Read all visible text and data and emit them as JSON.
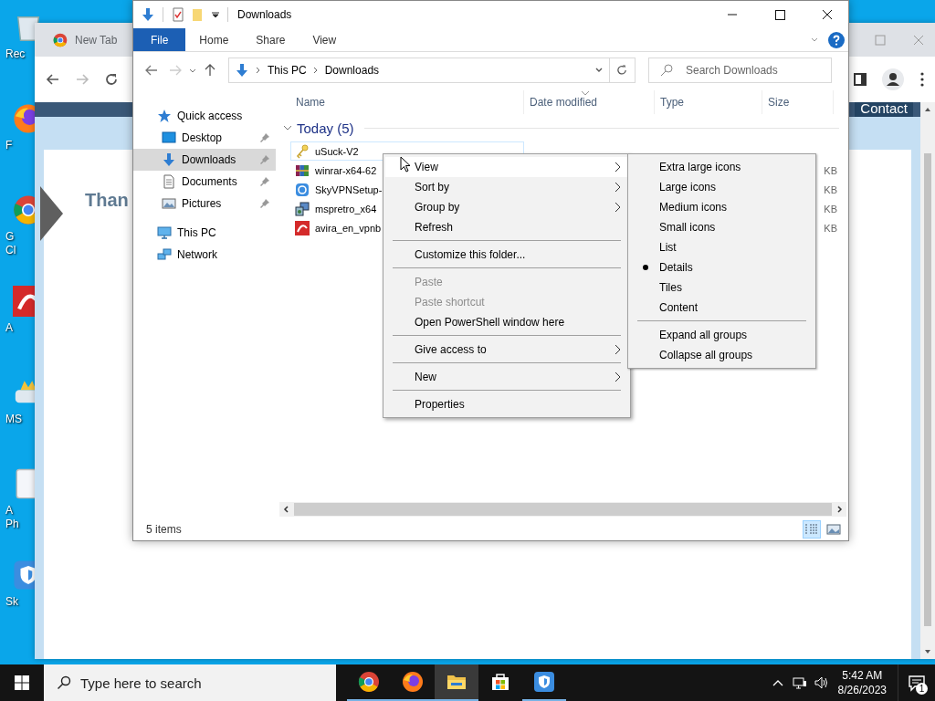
{
  "desktop": {
    "icons": [
      {
        "kind": "bin",
        "label": [
          "Rec"
        ]
      },
      {
        "kind": "firefox",
        "label": [
          "F"
        ]
      },
      {
        "kind": "chrome",
        "label": [
          "G",
          "Cl"
        ]
      },
      {
        "kind": "avira",
        "label": [
          "A"
        ]
      },
      {
        "kind": "game",
        "label": [
          "MS"
        ]
      },
      {
        "kind": "doc",
        "label": [
          "A",
          "Ph"
        ]
      },
      {
        "kind": "vpn",
        "label": [
          "Sk"
        ]
      }
    ]
  },
  "browser": {
    "tab": "New Tab",
    "banner_button": "Contact",
    "heading": "Than"
  },
  "explorer": {
    "title": "Downloads",
    "ribbon_tabs": [
      {
        "label": "File",
        "selected": true
      },
      {
        "label": "Home",
        "selected": false
      },
      {
        "label": "Share",
        "selected": false
      },
      {
        "label": "View",
        "selected": false
      }
    ],
    "breadcrumb": [
      "This PC",
      "Downloads"
    ],
    "search": {
      "placeholder": "Search Downloads"
    },
    "nav": [
      {
        "label": "Quick access",
        "kind": "star",
        "selected": false,
        "children": [
          {
            "label": "Desktop",
            "kind": "desktop",
            "pinned": true,
            "selected": false
          },
          {
            "label": "Downloads",
            "kind": "download",
            "pinned": true,
            "selected": true
          },
          {
            "label": "Documents",
            "kind": "document",
            "pinned": true,
            "selected": false
          },
          {
            "label": "Pictures",
            "kind": "pictures",
            "pinned": true,
            "selected": false
          }
        ]
      },
      {
        "label": "This PC",
        "kind": "pc",
        "selected": false
      },
      {
        "label": "Network",
        "kind": "network",
        "selected": false
      }
    ],
    "columns": [
      "Name",
      "Date modified",
      "Type",
      "Size"
    ],
    "group": {
      "label": "Today (5)",
      "expanded": true
    },
    "files": [
      {
        "name": "uSuck-V2",
        "kind": "key",
        "focused": true
      },
      {
        "name": "winrar-x64-62",
        "kind": "archive",
        "size": "KB",
        "focused": false
      },
      {
        "name": "SkyVPNSetup-",
        "kind": "vpn",
        "size": "KB",
        "focused": false
      },
      {
        "name": "mspretro_x64",
        "kind": "setup",
        "size": "KB",
        "focused": false
      },
      {
        "name": "avira_en_vpnb",
        "kind": "avira",
        "size": "KB",
        "focused": false
      }
    ],
    "status": "5 items",
    "view_buttons": [
      {
        "kind": "details",
        "selected": true
      },
      {
        "kind": "thumbnails",
        "selected": false
      }
    ]
  },
  "context_menu": [
    {
      "kind": "item",
      "label": "View",
      "submenu": true,
      "highlighted": true,
      "disabled": false
    },
    {
      "kind": "item",
      "label": "Sort by",
      "submenu": true,
      "highlighted": false,
      "disabled": false
    },
    {
      "kind": "item",
      "label": "Group by",
      "submenu": true,
      "highlighted": false,
      "disabled": false
    },
    {
      "kind": "item",
      "label": "Refresh",
      "submenu": false,
      "highlighted": false,
      "disabled": false
    },
    {
      "kind": "separator"
    },
    {
      "kind": "item",
      "label": "Customize this folder...",
      "submenu": false,
      "highlighted": false,
      "disabled": false
    },
    {
      "kind": "separator"
    },
    {
      "kind": "item",
      "label": "Paste",
      "submenu": false,
      "highlighted": false,
      "disabled": true
    },
    {
      "kind": "item",
      "label": "Paste shortcut",
      "submenu": false,
      "highlighted": false,
      "disabled": true
    },
    {
      "kind": "item",
      "label": "Open PowerShell window here",
      "submenu": false,
      "highlighted": false,
      "disabled": false
    },
    {
      "kind": "separator"
    },
    {
      "kind": "item",
      "label": "Give access to",
      "submenu": true,
      "highlighted": false,
      "disabled": false
    },
    {
      "kind": "separator"
    },
    {
      "kind": "item",
      "label": "New",
      "submenu": true,
      "highlighted": false,
      "disabled": false
    },
    {
      "kind": "separator"
    },
    {
      "kind": "item",
      "label": "Properties",
      "submenu": false,
      "highlighted": false,
      "disabled": false
    }
  ],
  "view_submenu": [
    {
      "kind": "item",
      "label": "Extra large icons",
      "selected": false
    },
    {
      "kind": "item",
      "label": "Large icons",
      "selected": false
    },
    {
      "kind": "item",
      "label": "Medium icons",
      "selected": false
    },
    {
      "kind": "item",
      "label": "Small icons",
      "selected": false
    },
    {
      "kind": "item",
      "label": "List",
      "selected": false
    },
    {
      "kind": "item",
      "label": "Details",
      "selected": true
    },
    {
      "kind": "item",
      "label": "Tiles",
      "selected": false
    },
    {
      "kind": "item",
      "label": "Content",
      "selected": false
    },
    {
      "kind": "separator"
    },
    {
      "kind": "item",
      "label": "Expand all groups",
      "selected": false
    },
    {
      "kind": "item",
      "label": "Collapse all groups",
      "selected": false
    }
  ],
  "taskbar": {
    "search": {
      "placeholder": "Type here to search"
    },
    "apps": [
      {
        "kind": "chrome",
        "active": false,
        "running": true
      },
      {
        "kind": "firefox",
        "active": false,
        "running": true
      },
      {
        "kind": "explorer",
        "active": true,
        "running": true
      },
      {
        "kind": "store",
        "active": false,
        "running": false
      },
      {
        "kind": "vpn",
        "active": false,
        "running": true
      }
    ],
    "time": "5:42 AM",
    "date": "8/26/2023",
    "notifications": "1"
  }
}
